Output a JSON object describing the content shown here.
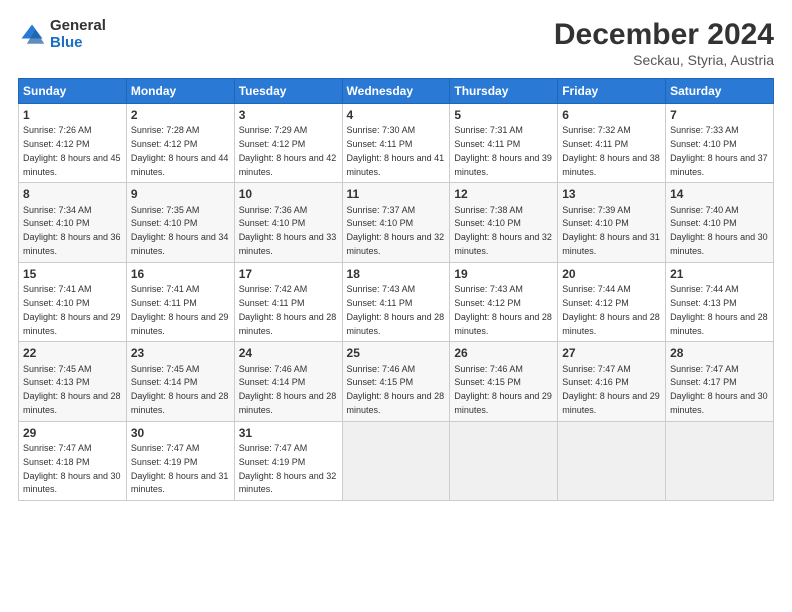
{
  "logo": {
    "general": "General",
    "blue": "Blue"
  },
  "header": {
    "title": "December 2024",
    "subtitle": "Seckau, Styria, Austria"
  },
  "weekdays": [
    "Sunday",
    "Monday",
    "Tuesday",
    "Wednesday",
    "Thursday",
    "Friday",
    "Saturday"
  ],
  "weeks": [
    [
      {
        "day": "1",
        "sunrise": "7:26 AM",
        "sunset": "4:12 PM",
        "daylight": "8 hours and 45 minutes."
      },
      {
        "day": "2",
        "sunrise": "7:28 AM",
        "sunset": "4:12 PM",
        "daylight": "8 hours and 44 minutes."
      },
      {
        "day": "3",
        "sunrise": "7:29 AM",
        "sunset": "4:12 PM",
        "daylight": "8 hours and 42 minutes."
      },
      {
        "day": "4",
        "sunrise": "7:30 AM",
        "sunset": "4:11 PM",
        "daylight": "8 hours and 41 minutes."
      },
      {
        "day": "5",
        "sunrise": "7:31 AM",
        "sunset": "4:11 PM",
        "daylight": "8 hours and 39 minutes."
      },
      {
        "day": "6",
        "sunrise": "7:32 AM",
        "sunset": "4:11 PM",
        "daylight": "8 hours and 38 minutes."
      },
      {
        "day": "7",
        "sunrise": "7:33 AM",
        "sunset": "4:10 PM",
        "daylight": "8 hours and 37 minutes."
      }
    ],
    [
      {
        "day": "8",
        "sunrise": "7:34 AM",
        "sunset": "4:10 PM",
        "daylight": "8 hours and 36 minutes."
      },
      {
        "day": "9",
        "sunrise": "7:35 AM",
        "sunset": "4:10 PM",
        "daylight": "8 hours and 34 minutes."
      },
      {
        "day": "10",
        "sunrise": "7:36 AM",
        "sunset": "4:10 PM",
        "daylight": "8 hours and 33 minutes."
      },
      {
        "day": "11",
        "sunrise": "7:37 AM",
        "sunset": "4:10 PM",
        "daylight": "8 hours and 32 minutes."
      },
      {
        "day": "12",
        "sunrise": "7:38 AM",
        "sunset": "4:10 PM",
        "daylight": "8 hours and 32 minutes."
      },
      {
        "day": "13",
        "sunrise": "7:39 AM",
        "sunset": "4:10 PM",
        "daylight": "8 hours and 31 minutes."
      },
      {
        "day": "14",
        "sunrise": "7:40 AM",
        "sunset": "4:10 PM",
        "daylight": "8 hours and 30 minutes."
      }
    ],
    [
      {
        "day": "15",
        "sunrise": "7:41 AM",
        "sunset": "4:10 PM",
        "daylight": "8 hours and 29 minutes."
      },
      {
        "day": "16",
        "sunrise": "7:41 AM",
        "sunset": "4:11 PM",
        "daylight": "8 hours and 29 minutes."
      },
      {
        "day": "17",
        "sunrise": "7:42 AM",
        "sunset": "4:11 PM",
        "daylight": "8 hours and 28 minutes."
      },
      {
        "day": "18",
        "sunrise": "7:43 AM",
        "sunset": "4:11 PM",
        "daylight": "8 hours and 28 minutes."
      },
      {
        "day": "19",
        "sunrise": "7:43 AM",
        "sunset": "4:12 PM",
        "daylight": "8 hours and 28 minutes."
      },
      {
        "day": "20",
        "sunrise": "7:44 AM",
        "sunset": "4:12 PM",
        "daylight": "8 hours and 28 minutes."
      },
      {
        "day": "21",
        "sunrise": "7:44 AM",
        "sunset": "4:13 PM",
        "daylight": "8 hours and 28 minutes."
      }
    ],
    [
      {
        "day": "22",
        "sunrise": "7:45 AM",
        "sunset": "4:13 PM",
        "daylight": "8 hours and 28 minutes."
      },
      {
        "day": "23",
        "sunrise": "7:45 AM",
        "sunset": "4:14 PM",
        "daylight": "8 hours and 28 minutes."
      },
      {
        "day": "24",
        "sunrise": "7:46 AM",
        "sunset": "4:14 PM",
        "daylight": "8 hours and 28 minutes."
      },
      {
        "day": "25",
        "sunrise": "7:46 AM",
        "sunset": "4:15 PM",
        "daylight": "8 hours and 28 minutes."
      },
      {
        "day": "26",
        "sunrise": "7:46 AM",
        "sunset": "4:15 PM",
        "daylight": "8 hours and 29 minutes."
      },
      {
        "day": "27",
        "sunrise": "7:47 AM",
        "sunset": "4:16 PM",
        "daylight": "8 hours and 29 minutes."
      },
      {
        "day": "28",
        "sunrise": "7:47 AM",
        "sunset": "4:17 PM",
        "daylight": "8 hours and 30 minutes."
      }
    ],
    [
      {
        "day": "29",
        "sunrise": "7:47 AM",
        "sunset": "4:18 PM",
        "daylight": "8 hours and 30 minutes."
      },
      {
        "day": "30",
        "sunrise": "7:47 AM",
        "sunset": "4:19 PM",
        "daylight": "8 hours and 31 minutes."
      },
      {
        "day": "31",
        "sunrise": "7:47 AM",
        "sunset": "4:19 PM",
        "daylight": "8 hours and 32 minutes."
      },
      null,
      null,
      null,
      null
    ]
  ]
}
